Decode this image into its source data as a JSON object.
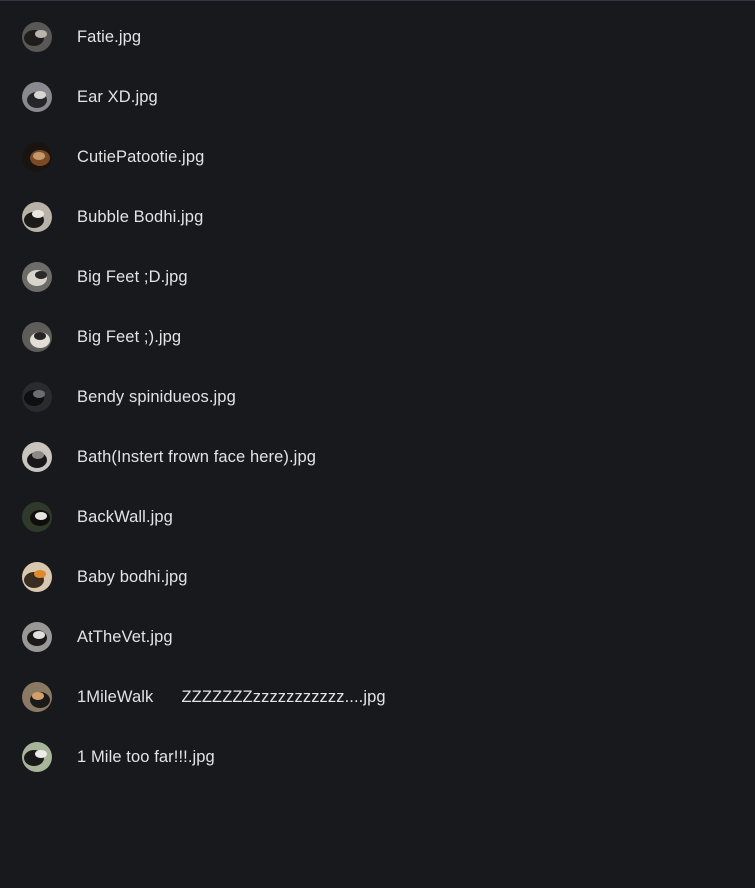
{
  "files": [
    {
      "name": "Fatie.jpg",
      "thumb_icon": "dog-photo-thumbnail",
      "colors": [
        "#5a5856",
        "#1e1d1c",
        "#b9b4ac"
      ]
    },
    {
      "name": "Ear XD.jpg",
      "thumb_icon": "dog-photo-thumbnail",
      "colors": [
        "#8a8a8e",
        "#262628",
        "#d8d6d2"
      ]
    },
    {
      "name": "CutiePatootie.jpg",
      "thumb_icon": "dog-photo-thumbnail",
      "colors": [
        "#1a1410",
        "#7a4a26",
        "#c49a6c"
      ]
    },
    {
      "name": "Bubble Bodhi.jpg",
      "thumb_icon": "dog-photo-thumbnail",
      "colors": [
        "#b8b2a8",
        "#1c1b1a",
        "#e9e6e0"
      ]
    },
    {
      "name": "Big Feet ;D.jpg",
      "thumb_icon": "dog-photo-thumbnail",
      "colors": [
        "#6e6c69",
        "#d8d4cc",
        "#2a2927"
      ]
    },
    {
      "name": "Big Feet ;).jpg",
      "thumb_icon": "dog-photo-thumbnail",
      "colors": [
        "#5f5d5a",
        "#e2ded6",
        "#262422"
      ]
    },
    {
      "name": "Bendy spinidueos.jpg",
      "thumb_icon": "dog-photo-thumbnail",
      "colors": [
        "#2a2b2e",
        "#0f0f10",
        "#6b6d72"
      ]
    },
    {
      "name": "Bath(Instert frown face here).jpg",
      "thumb_icon": "dog-photo-thumbnail",
      "colors": [
        "#c9c5be",
        "#18181a",
        "#8c8883"
      ]
    },
    {
      "name": "BackWall.jpg",
      "thumb_icon": "dog-photo-thumbnail",
      "colors": [
        "#2f3a2a",
        "#0e0e0e",
        "#e6e4df"
      ]
    },
    {
      "name": "Baby bodhi.jpg",
      "thumb_icon": "dog-photo-thumbnail",
      "colors": [
        "#d8c8b0",
        "#3a2e22",
        "#e08a2c"
      ]
    },
    {
      "name": "AtTheVet.jpg",
      "thumb_icon": "dog-photo-thumbnail",
      "colors": [
        "#9a9896",
        "#1a1918",
        "#e2e0dc"
      ]
    },
    {
      "name": "1MileWalk      ZZZZZZZzzzzzzzzzzz....jpg",
      "thumb_icon": "dog-photo-thumbnail",
      "colors": [
        "#8a7a64",
        "#1c1a18",
        "#d4a06a"
      ]
    },
    {
      "name": "1 Mile too far!!!.jpg",
      "thumb_icon": "dog-photo-thumbnail",
      "colors": [
        "#a8b59a",
        "#1a1a1a",
        "#ecebe8"
      ]
    }
  ]
}
